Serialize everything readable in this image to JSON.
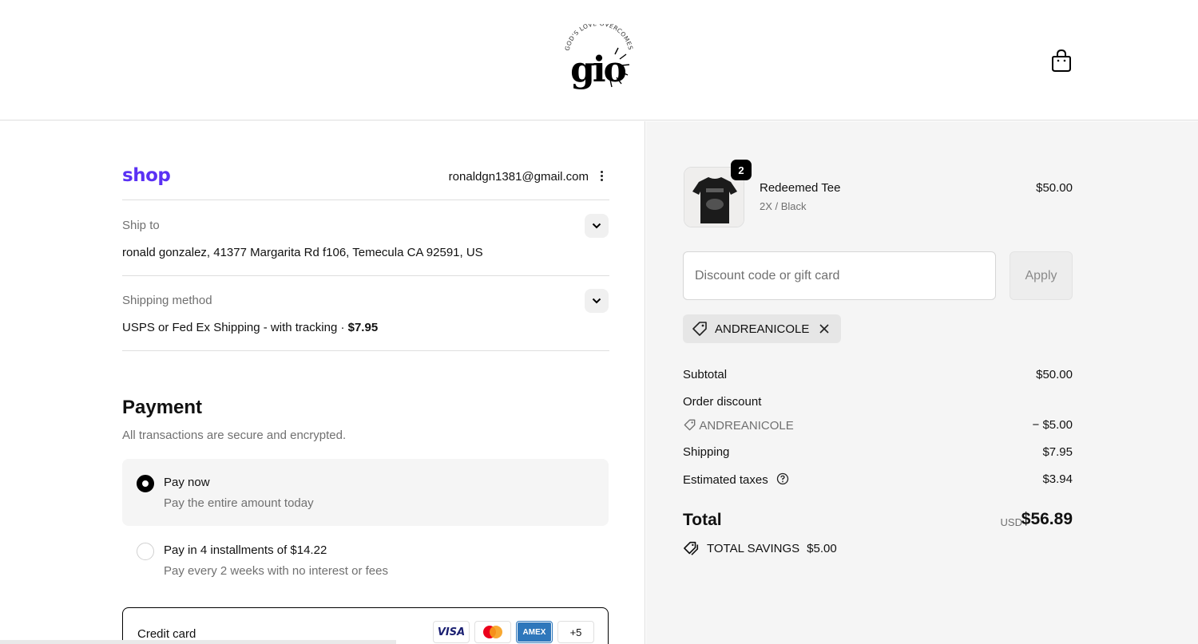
{
  "header": {
    "brand_logo": "gio",
    "brand_tagline": "GOD'S LOVE OVERCOMES",
    "cart_icon": "shopping-bag-icon"
  },
  "account": {
    "shop_logo_text": "shop",
    "email": "ronaldgn1381@gmail.com"
  },
  "ship_to": {
    "label": "Ship to",
    "value": "ronald gonzalez, 41377 Margarita Rd f106, Temecula CA 92591, US"
  },
  "shipping_method": {
    "label": "Shipping method",
    "value": "USPS or Fed Ex Shipping - with tracking · ",
    "price": "$7.95"
  },
  "payment": {
    "title": "Payment",
    "subtitle": "All transactions are secure and encrypted.",
    "options": [
      {
        "title": "Pay now",
        "subtitle": "Pay the entire amount today",
        "selected": true
      },
      {
        "title": "Pay in 4 installments of $14.22",
        "subtitle": "Pay every 2 weeks with no interest or fees",
        "selected": false
      }
    ],
    "credit_card": {
      "label": "Credit card",
      "brands": [
        "VISA",
        "Mastercard",
        "AMEX"
      ],
      "more": "+5"
    }
  },
  "cart": {
    "item": {
      "name": "Redeemed Tee",
      "variant": "2X / Black",
      "price": "$50.00",
      "quantity": "2"
    },
    "discount_input": {
      "placeholder": "Discount code or gift card",
      "value": ""
    },
    "apply_label": "Apply",
    "applied_code": "ANDREANICOLE",
    "summary": {
      "subtotal_label": "Subtotal",
      "subtotal": "$50.00",
      "order_discount_label": "Order discount",
      "discount_code": "ANDREANICOLE",
      "discount_amount": "− $5.00",
      "shipping_label": "Shipping",
      "shipping": "$7.95",
      "taxes_label": "Estimated taxes",
      "taxes": "$3.94",
      "total_label": "Total",
      "currency": "USD",
      "total": "$56.89",
      "savings_label": "TOTAL SAVINGS",
      "savings": "$5.00"
    }
  },
  "colors": {
    "shop_brand": "#5a31f4",
    "summary_bg": "#f5f5f5",
    "text_muted": "#707070"
  }
}
